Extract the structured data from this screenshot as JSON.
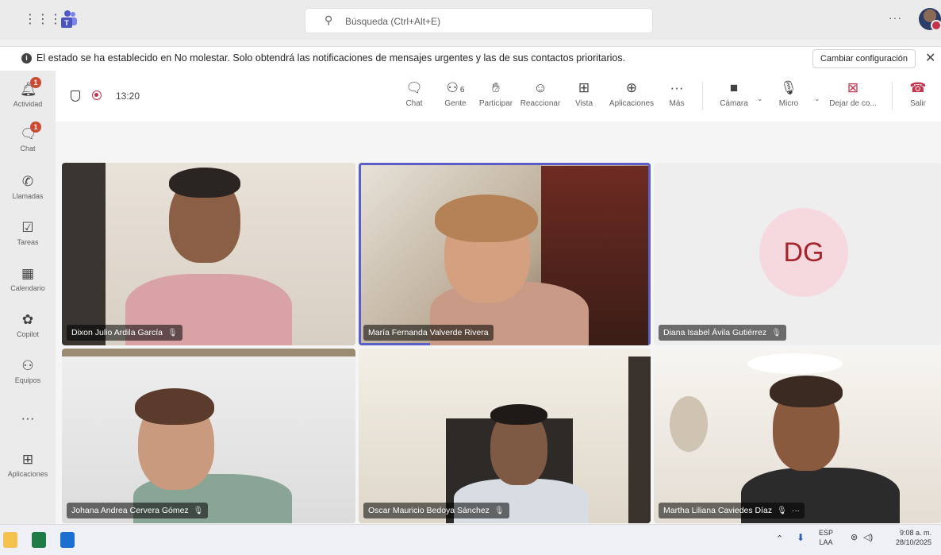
{
  "search": {
    "placeholder": "Búsqueda (Ctrl+Alt+E)"
  },
  "banner": {
    "message": "El estado se ha establecido en No molestar. Solo obtendrá las notificaciones de mensajes urgentes y las de sus contactos prioritarios.",
    "action": "Cambiar configuración"
  },
  "rail": [
    {
      "label": "Actividad",
      "icon": "bell-icon",
      "badge": "1"
    },
    {
      "label": "Chat",
      "icon": "chat-icon",
      "badge": "1"
    },
    {
      "label": "Llamadas",
      "icon": "phone-icon"
    },
    {
      "label": "Tareas",
      "icon": "tasks-icon"
    },
    {
      "label": "Calendario",
      "icon": "calendar-icon"
    },
    {
      "label": "Copilot",
      "icon": "copilot-icon"
    },
    {
      "label": "Equipos",
      "icon": "teams-icon"
    },
    {
      "label": "Aplicaciones",
      "icon": "add-icon"
    }
  ],
  "meeting": {
    "timer": "13:20"
  },
  "toolbar": {
    "chat": "Chat",
    "people": "Gente",
    "people_count": "6",
    "raise": "Participar",
    "react": "Reaccionar",
    "view": "Vista",
    "apps": "Aplicaciones",
    "more": "Más",
    "camera": "Cámara",
    "mic": "Micro",
    "stop_share": "Dejar de co...",
    "leave": "Salir"
  },
  "participants": [
    {
      "name": "Dixon Julio Ardila García"
    },
    {
      "name": "María Fernanda Valverde Rivera"
    },
    {
      "name": "Diana Isabel Ávila Gutiérrez",
      "initials": "DG"
    },
    {
      "name": "Johana Andrea Cervera Gómez"
    },
    {
      "name": "Oscar Mauricio Bedoya Sánchez"
    },
    {
      "name": "Martha Liliana Caviedes Díaz"
    }
  ],
  "taskbar": {
    "lang": "ESP",
    "lang_sub": "LAA",
    "time": "9:08 a. m.",
    "date": "28/10/2025"
  },
  "colors": {
    "accent": "#5b5fc7",
    "badge": "#cc4a31",
    "leave": "#c4314b"
  }
}
